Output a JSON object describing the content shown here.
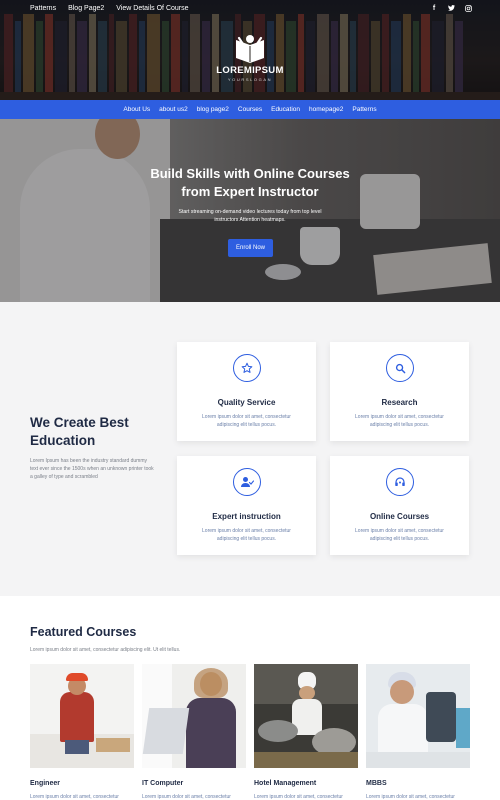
{
  "top_bar": {
    "links": [
      "Patterns",
      "Blog Page2",
      "View Details Of Course"
    ],
    "socials": [
      "facebook-icon",
      "twitter-icon",
      "instagram-icon"
    ]
  },
  "logo": {
    "name": "LOREMIPSUM",
    "slogan": "YOURSLOGAN"
  },
  "nav": [
    "About Us",
    "about us2",
    "blog page2",
    "Courses",
    "Education",
    "homepage2",
    "Patterns"
  ],
  "hero": {
    "title_line1": "Build Skills with Online Courses",
    "title_line2": "from Expert Instructor",
    "subtitle_line1": "Start streaming on-demand video lectures today from top level",
    "subtitle_line2": "instructors Attention heatmaps.",
    "cta": "Enroll Now"
  },
  "features": {
    "heading_line1": "We Create Best",
    "heading_line2": "Education",
    "description": "Lorem Ipsum has been the industry standard dummy text ever since the 1500s when an unknown printer took a galley of type and scrambled",
    "cards": [
      {
        "icon": "star-icon",
        "title": "Quality Service",
        "text": "Lorem ipsum dolor sit amet, consectetur adipiscing elit tellus pocus."
      },
      {
        "icon": "search-icon",
        "title": "Research",
        "text": "Lorem ipsum dolor sit amet, consectetur adipiscing elit tellus pocus."
      },
      {
        "icon": "user-check-icon",
        "title": "Expert instruction",
        "text": "Lorem ipsum dolor sit amet, consectetur adipiscing elit tellus pocus."
      },
      {
        "icon": "headset-icon",
        "title": "Online Courses",
        "text": "Lorem ipsum dolor sit amet, consectetur adipiscing elit tellus pocus."
      }
    ]
  },
  "courses": {
    "title": "Featured Courses",
    "subtitle": "Lorem ipsum dolor sit amet, consectetur adipiscing elit. Ut elit tellus.",
    "items": [
      {
        "name": "Engineer",
        "desc": "Lorem ipsum dolor sit amet, consectetur"
      },
      {
        "name": "IT Computer",
        "desc": "Lorem ipsum dolor sit amet, consectetur"
      },
      {
        "name": "Hotel Management",
        "desc": "Lorem ipsum dolor sit amet, consectetur"
      },
      {
        "name": "MBBS",
        "desc": "Lorem ipsum dolor sit amet, consectetur"
      }
    ]
  },
  "colors": {
    "accent": "#2e5ee0",
    "heading": "#1f2a44",
    "section_bg": "#f4f4f5"
  }
}
